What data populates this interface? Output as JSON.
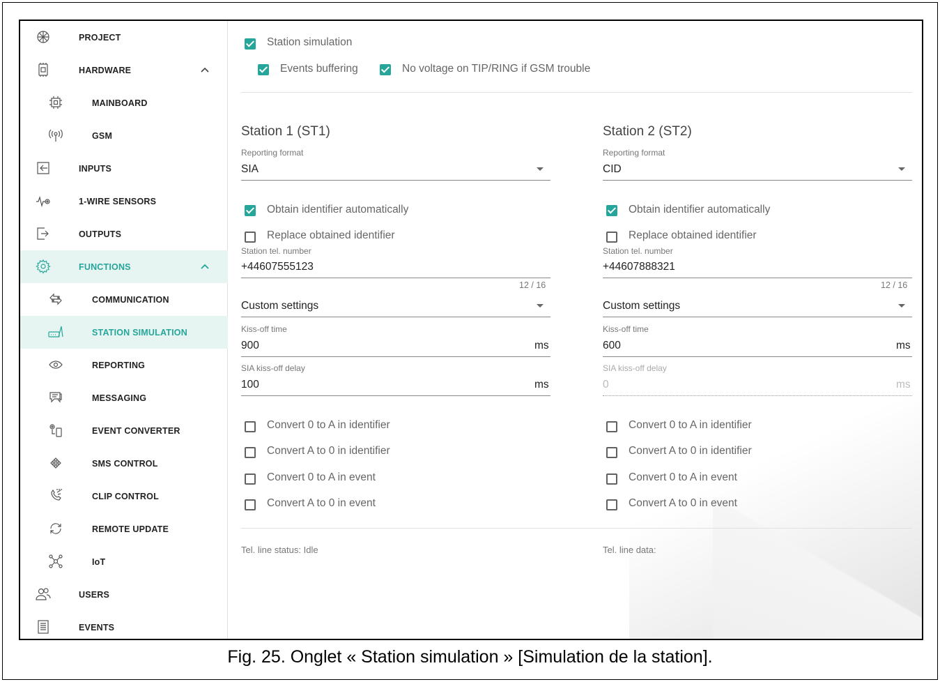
{
  "sidebar": {
    "items": [
      {
        "label": "PROJECT",
        "icon": "project-icon"
      },
      {
        "label": "HARDWARE",
        "icon": "hardware-icon"
      },
      {
        "label": "MAINBOARD",
        "icon": "mainboard-icon"
      },
      {
        "label": "GSM",
        "icon": "gsm-antenna-icon"
      },
      {
        "label": "INPUTS",
        "icon": "inputs-icon"
      },
      {
        "label": "1-WIRE SENSORS",
        "icon": "sensor-icon"
      },
      {
        "label": "OUTPUTS",
        "icon": "outputs-icon"
      },
      {
        "label": "FUNCTIONS",
        "icon": "gear-icon"
      },
      {
        "label": "COMMUNICATION",
        "icon": "communication-icon"
      },
      {
        "label": "STATION SIMULATION",
        "icon": "station-simulation-icon"
      },
      {
        "label": "REPORTING",
        "icon": "eye-icon"
      },
      {
        "label": "MESSAGING",
        "icon": "chat-icon"
      },
      {
        "label": "EVENT CONVERTER",
        "icon": "event-converter-icon"
      },
      {
        "label": "SMS CONTROL",
        "icon": "sms-control-icon"
      },
      {
        "label": "CLIP CONTROL",
        "icon": "phone-icon"
      },
      {
        "label": "REMOTE UPDATE",
        "icon": "refresh-icon"
      },
      {
        "label": "IoT",
        "icon": "iot-icon"
      },
      {
        "label": "USERS",
        "icon": "users-icon"
      },
      {
        "label": "EVENTS",
        "icon": "events-list-icon"
      }
    ]
  },
  "top_options": {
    "station_simulation": {
      "label": "Station simulation",
      "checked": true
    },
    "events_buffering": {
      "label": "Events buffering",
      "checked": true
    },
    "no_voltage": {
      "label": "No voltage on TIP/RING if GSM trouble",
      "checked": true
    }
  },
  "stations": [
    {
      "title": "Station 1 (ST1)",
      "reporting_format_label": "Reporting format",
      "reporting_format": "SIA",
      "obtain_identifier": {
        "label": "Obtain identifier automatically",
        "checked": true
      },
      "replace_identifier": {
        "label": "Replace obtained identifier",
        "checked": false
      },
      "tel_label": "Station tel. number",
      "tel_value": "+44607555123",
      "tel_counter": "12 / 16",
      "settings_select": "Custom settings",
      "kissoff_label": "Kiss-off time",
      "kissoff_value": "900",
      "kissoff_unit": "ms",
      "sia_delay_label": "SIA kiss-off delay",
      "sia_delay_value": "100",
      "sia_delay_unit": "ms",
      "sia_delay_disabled": false,
      "conversions": [
        {
          "label": "Convert 0 to A in identifier",
          "checked": false
        },
        {
          "label": "Convert A to 0 in identifier",
          "checked": false
        },
        {
          "label": "Convert 0 to A in event",
          "checked": false
        },
        {
          "label": "Convert A to 0 in event",
          "checked": false
        }
      ],
      "status": "Tel. line status: Idle"
    },
    {
      "title": "Station 2 (ST2)",
      "reporting_format_label": "Reporting format",
      "reporting_format": "CID",
      "obtain_identifier": {
        "label": "Obtain identifier automatically",
        "checked": true
      },
      "replace_identifier": {
        "label": "Replace obtained identifier",
        "checked": false
      },
      "tel_label": "Station tel. number",
      "tel_value": "+44607888321",
      "tel_counter": "12 / 16",
      "settings_select": "Custom settings",
      "kissoff_label": "Kiss-off time",
      "kissoff_value": "600",
      "kissoff_unit": "ms",
      "sia_delay_label": "SIA kiss-off delay",
      "sia_delay_value": "0",
      "sia_delay_unit": "ms",
      "sia_delay_disabled": true,
      "conversions": [
        {
          "label": "Convert 0 to A in identifier",
          "checked": false
        },
        {
          "label": "Convert A to 0 in identifier",
          "checked": false
        },
        {
          "label": "Convert 0 to A in event",
          "checked": false
        },
        {
          "label": "Convert A to 0 in event",
          "checked": false
        }
      ],
      "status": "Tel. line data:"
    }
  ],
  "caption": "Fig. 25. Onglet « Station simulation » [Simulation de la station].",
  "colors": {
    "accent": "#26a69a",
    "active_bg": "#e6f5f2"
  }
}
